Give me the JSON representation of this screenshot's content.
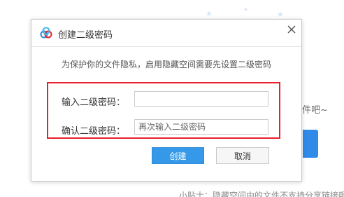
{
  "background": {
    "side_text": "件吧~",
    "tip_text": "小贴士：隐藏空间中的文件不支持分享链接哦"
  },
  "dialog": {
    "title": "创建二级密码",
    "hint": "为保护你的文件隐私，启用隐藏空间需要先设置二级密码",
    "password_label": "输入二级密码：",
    "password_value": "",
    "confirm_label": "确认二级密码：",
    "confirm_placeholder": "再次输入二级密码",
    "create_button": "创建",
    "cancel_button": "取消"
  },
  "icons": {
    "logo": "baidu-cloud-logo-icon",
    "close": "close-icon",
    "decoration": "star-icon"
  },
  "colors": {
    "primary": "#3598e8",
    "highlight": "#e8212a",
    "background_accent": "#2f8ae8"
  }
}
